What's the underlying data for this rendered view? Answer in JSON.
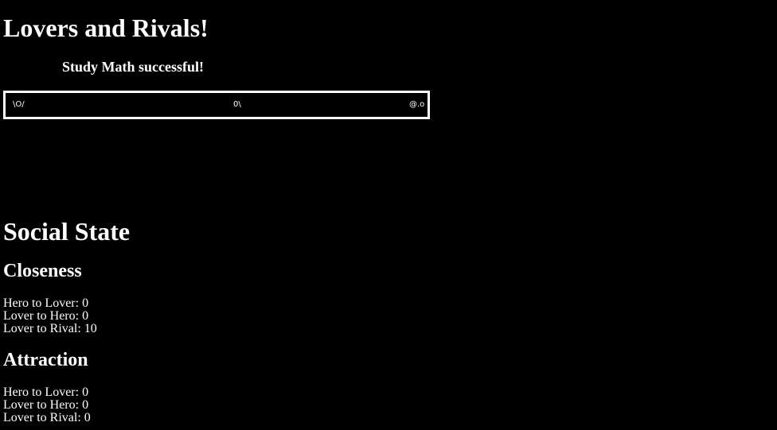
{
  "title": "Lovers and Rivals!",
  "status": "Study Math successful!",
  "stage": {
    "border_color": "#ffffff",
    "characters": [
      {
        "role": "hero",
        "sprite": "\\O/"
      },
      {
        "role": "lover",
        "sprite": "0\\"
      },
      {
        "role": "rival",
        "sprite": "@.o"
      }
    ]
  },
  "social_state": {
    "heading": "Social State",
    "closeness": {
      "heading": "Closeness",
      "rows": [
        {
          "label": "Hero to Lover:",
          "value": "0"
        },
        {
          "label": "Lover to Hero:",
          "value": "0"
        },
        {
          "label": "Lover to Rival:",
          "value": "10"
        }
      ]
    },
    "attraction": {
      "heading": "Attraction",
      "rows": [
        {
          "label": "Hero to Lover:",
          "value": "0"
        },
        {
          "label": "Lover to Hero:",
          "value": "0"
        },
        {
          "label": "Lover to Rival:",
          "value": "0"
        }
      ]
    }
  },
  "colors": {
    "background": "#000000",
    "text": "#ffffff"
  }
}
